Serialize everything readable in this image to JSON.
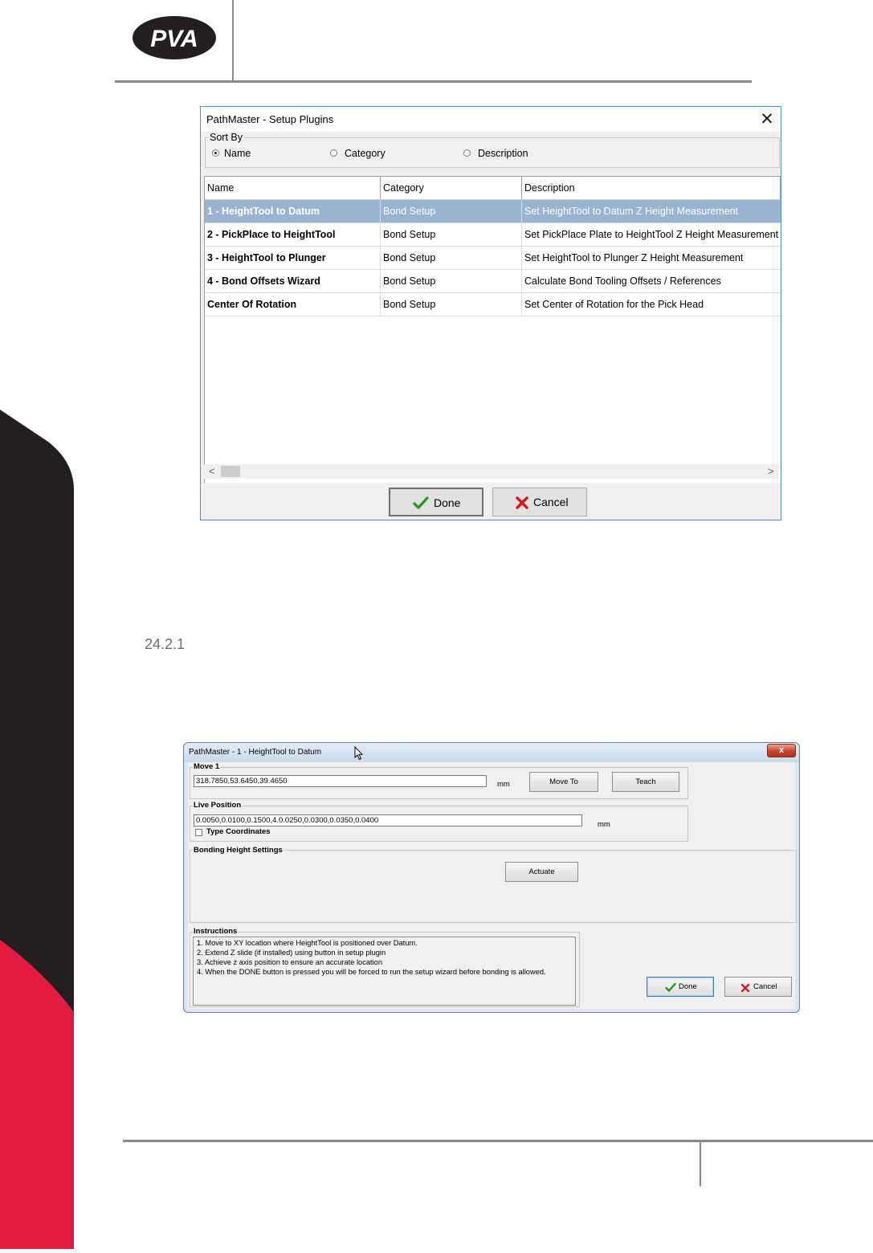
{
  "brand": {
    "logo_text": "PVA",
    "colors": {
      "dark": "#231f20",
      "red": "#e31b3e"
    }
  },
  "section": {
    "number": "24.2.1"
  },
  "setup_plugins": {
    "title": "PathMaster - Setup Plugins",
    "close_glyph": "✕",
    "sort_by": {
      "legend": "Sort By",
      "options": [
        {
          "label": "Name",
          "selected": true
        },
        {
          "label": "Category",
          "selected": false
        },
        {
          "label": "Description",
          "selected": false
        }
      ]
    },
    "columns": [
      "Name",
      "Category",
      "Description"
    ],
    "rows": [
      {
        "name": "1 - HeightTool to Datum",
        "category": "Bond Setup",
        "description": "Set HeightTool to Datum Z Height Measurement",
        "selected": true
      },
      {
        "name": "2 - PickPlace to HeightTool",
        "category": "Bond Setup",
        "description": "Set PickPlace Plate to HeightTool Z Height Measurement",
        "selected": false
      },
      {
        "name": "3 - HeightTool to Plunger",
        "category": "Bond Setup",
        "description": "Set HeightTool to Plunger Z Height Measurement",
        "selected": false
      },
      {
        "name": "4 - Bond Offsets Wizard",
        "category": "Bond Setup",
        "description": "Calculate Bond Tooling Offsets / References",
        "selected": false
      },
      {
        "name": "Center Of Rotation",
        "category": "Bond Setup",
        "description": "Set Center of Rotation for the Pick Head",
        "selected": false
      }
    ],
    "scroll_left": "<",
    "scroll_right": ">",
    "done_label": "Done",
    "cancel_label": "Cancel"
  },
  "heighttool_datum": {
    "title": "PathMaster - 1 - HeightTool to Datum",
    "close_glyph": "x",
    "move1": {
      "legend": "Move 1",
      "value": "318.7850,53.6450,39.4650",
      "unit": "mm",
      "move_to_label": "Move To",
      "teach_label": "Teach"
    },
    "live_position": {
      "legend": "Live Position",
      "value": "0.0050,0.0100,0.1500,4.0.0250,0.0300,0.0350,0.0400",
      "unit": "mm",
      "type_coordinates_label": "Type Coordinates",
      "type_coordinates_checked": false
    },
    "bonding_height": {
      "legend": "Bonding Height Settings",
      "actuate_label": "Actuate"
    },
    "instructions": {
      "legend": "Instructions",
      "lines": [
        "1. Move to XY location where HeightTool is positioned over Datum.",
        "2. Extend Z slide (if installed) using button in setup plugin",
        "3. Achieve z axis position to ensure an accurate location",
        "4. When the DONE button is pressed you will be forced to run the setup wizard before bonding is allowed."
      ]
    },
    "done_label": "Done",
    "cancel_label": "Cancel"
  }
}
